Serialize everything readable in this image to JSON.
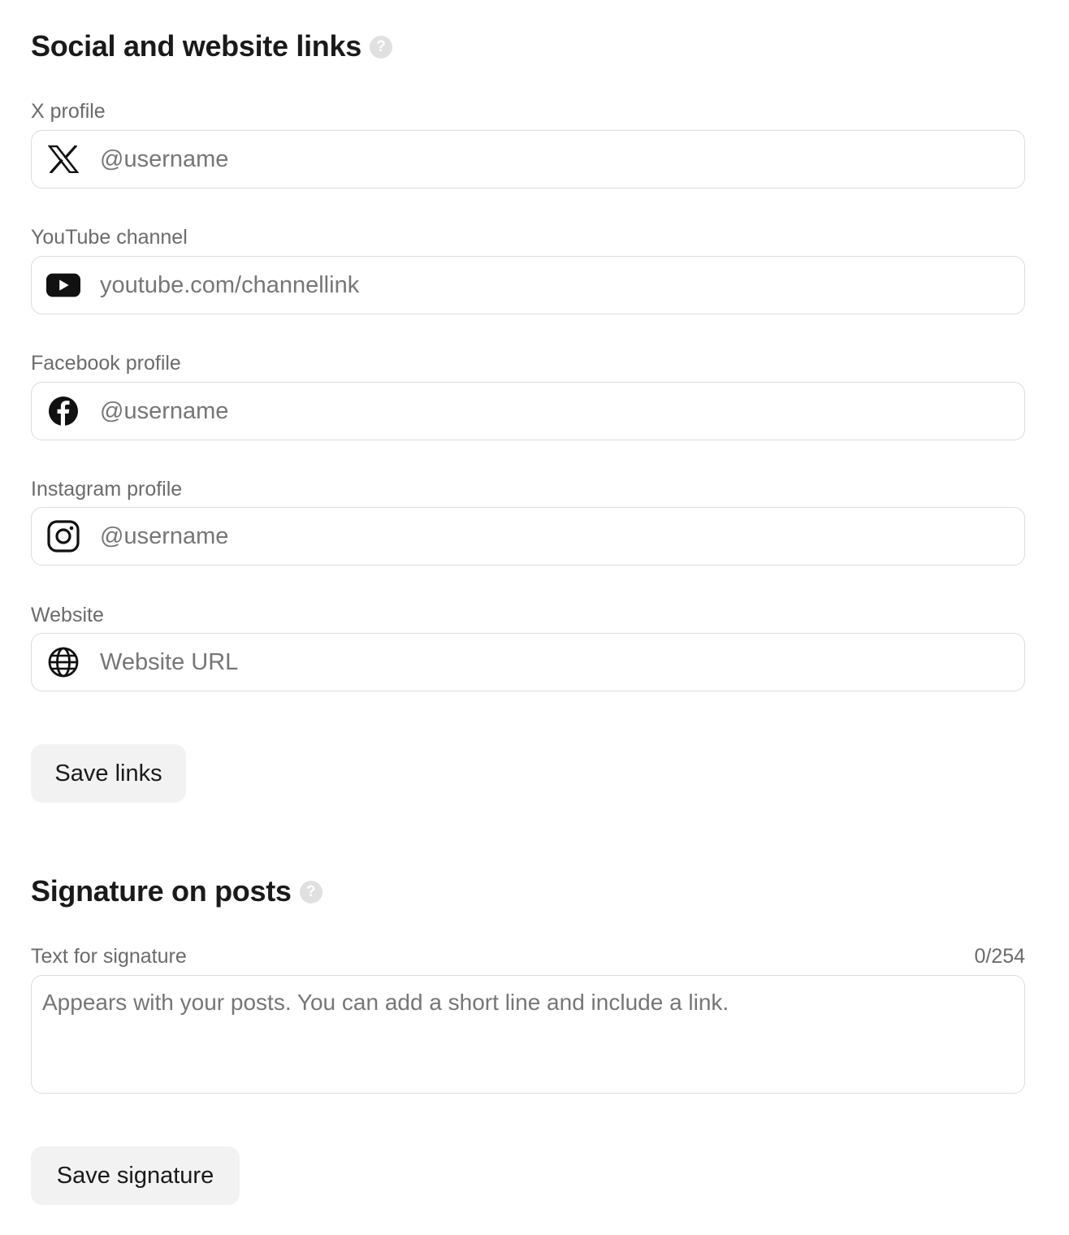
{
  "links_section": {
    "heading": "Social and website links",
    "help_glyph": "?",
    "fields": [
      {
        "id": "x",
        "label": "X profile",
        "placeholder": "@username",
        "value": "",
        "icon": "x-logo-icon"
      },
      {
        "id": "youtube",
        "label": "YouTube channel",
        "placeholder": "youtube.com/channellink",
        "value": "",
        "icon": "youtube-logo-icon"
      },
      {
        "id": "facebook",
        "label": "Facebook profile",
        "placeholder": "@username",
        "value": "",
        "icon": "facebook-logo-icon"
      },
      {
        "id": "instagram",
        "label": "Instagram profile",
        "placeholder": "@username",
        "value": "",
        "icon": "instagram-logo-icon"
      },
      {
        "id": "website",
        "label": "Website",
        "placeholder": "Website URL",
        "value": "",
        "icon": "globe-icon"
      }
    ],
    "save_label": "Save links"
  },
  "signature_section": {
    "heading": "Signature on posts",
    "help_glyph": "?",
    "label": "Text for signature",
    "counter": "0/254",
    "placeholder": "Appears with your posts. You can add a short line and include a link.",
    "value": "",
    "save_label": "Save signature"
  },
  "colors": {
    "text": "#1a1a1a",
    "label": "#6b6b6b",
    "placeholder": "#767676",
    "border": "#dcdcdc",
    "button_bg": "#f2f2f2",
    "help_icon_bg": "#e0e0e0"
  }
}
